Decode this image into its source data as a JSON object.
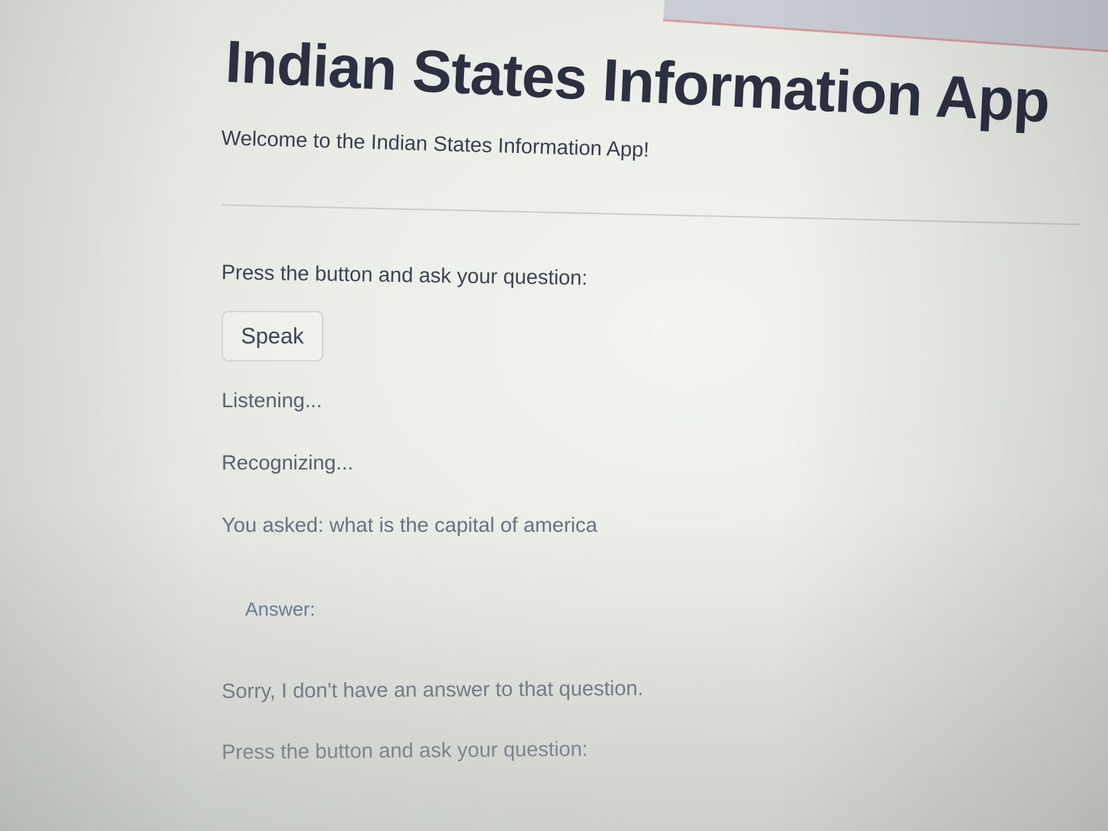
{
  "app": {
    "title": "Indian States Information App",
    "welcome": "Welcome to the Indian States Information App!"
  },
  "interaction": {
    "prompt": "Press the button and ask your question:",
    "speak_button_label": "Speak",
    "status_listening": "Listening...",
    "status_recognizing": "Recognizing...",
    "asked": "You asked: what is the capital of america",
    "answer_label": "Answer:",
    "answer_text": "Sorry, I don't have an answer to that question.",
    "prompt_repeat": "Press the button and ask your question:"
  }
}
